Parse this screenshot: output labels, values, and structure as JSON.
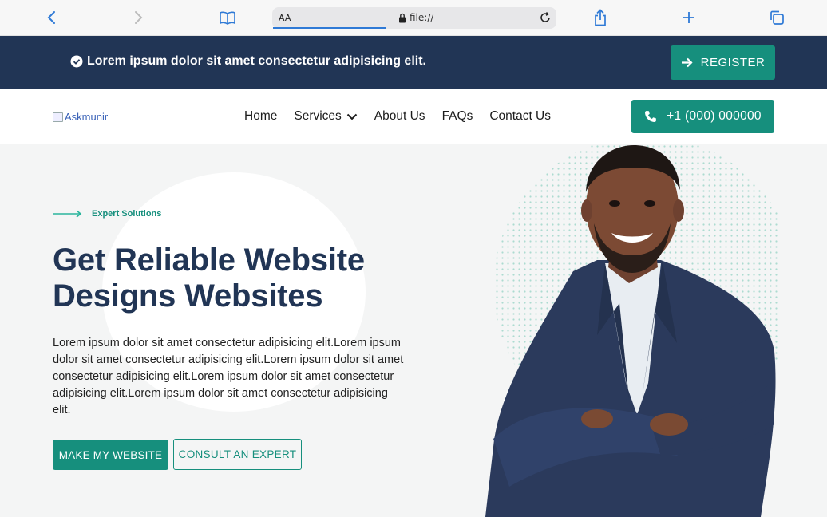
{
  "browser": {
    "text_size_label": "AA",
    "url": "file://"
  },
  "announcement": {
    "text": "Lorem ipsum dolor sit amet consectetur adipisicing elit.",
    "register_label": "REGISTER"
  },
  "brand": {
    "logo_alt": "Askmunir"
  },
  "nav": {
    "items": [
      {
        "label": "Home"
      },
      {
        "label": "Services"
      },
      {
        "label": "About Us"
      },
      {
        "label": "FAQs"
      },
      {
        "label": "Contact Us"
      }
    ],
    "phone_label": "+1 (000) 000000"
  },
  "hero": {
    "eyebrow": "Expert Solutions",
    "headline_line1": "Get Reliable Website",
    "headline_line2": "Designs Websites",
    "body": "Lorem ipsum dolor sit amet consectetur adipisicing elit.Lorem ipsum dolor sit amet consectetur adipisicing elit.Lorem ipsum dolor sit amet consectetur adipisicing elit.Lorem ipsum dolor sit amet consectetur adipisicing elit.Lorem ipsum dolor sit amet consectetur adipisicing elit.",
    "primary_cta": "MAKE MY WEBSITE",
    "secondary_cta": "CONSULT AN EXPERT"
  },
  "colors": {
    "navy": "#213555",
    "teal": "#168f7d",
    "browser_blue": "#2f7ad6"
  }
}
